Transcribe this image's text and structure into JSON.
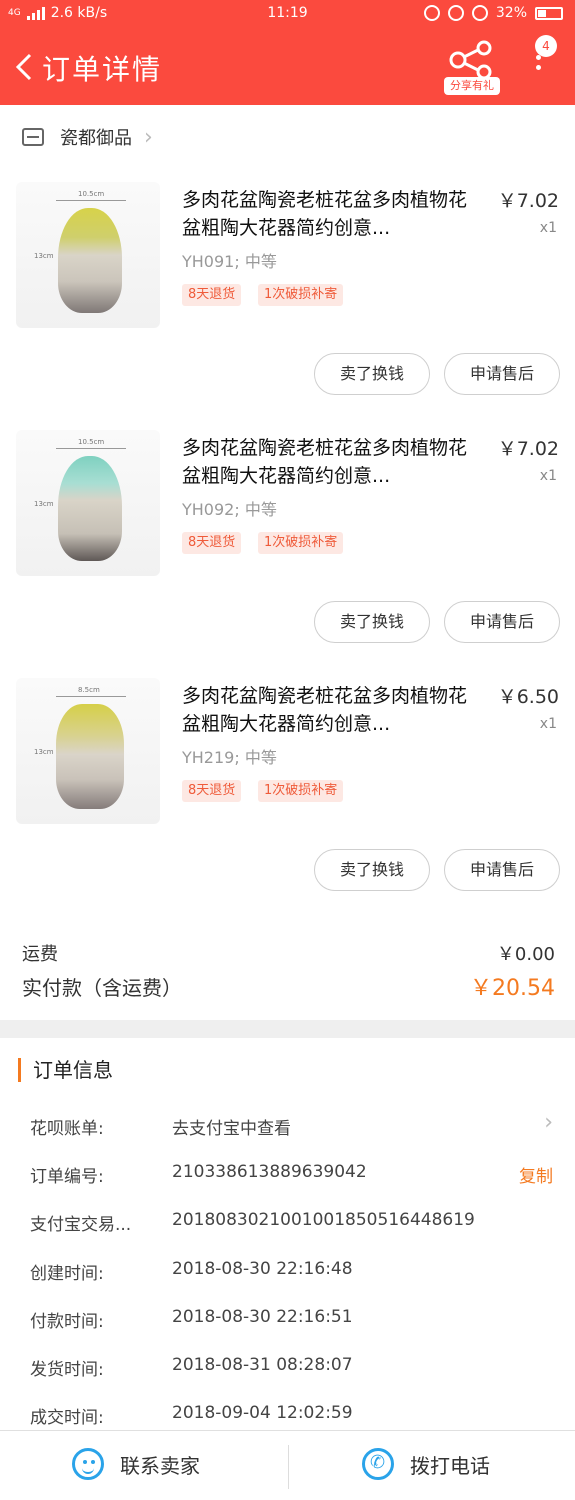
{
  "status_bar": {
    "network": "4G",
    "speed": "2.6 kB/s",
    "time": "11:19",
    "battery": "32%"
  },
  "header": {
    "title": "订单详情",
    "share_label": "分享有礼",
    "badge": "4"
  },
  "store": {
    "name": "瓷都御品"
  },
  "products": [
    {
      "name": "多肉花盆陶瓷老桩花盆多肉植物花盆粗陶大花器简约创意...",
      "price": "￥7.02",
      "qty": "x1",
      "sku": "YH091; 中等",
      "tags": [
        "8天退货",
        "1次破损补寄"
      ],
      "buttons": {
        "sell": "卖了换钱",
        "after_sale": "申请售后"
      }
    },
    {
      "name": "多肉花盆陶瓷老桩花盆多肉植物花盆粗陶大花器简约创意...",
      "price": "￥7.02",
      "qty": "x1",
      "sku": "YH092; 中等",
      "tags": [
        "8天退货",
        "1次破损补寄"
      ],
      "buttons": {
        "sell": "卖了换钱",
        "after_sale": "申请售后"
      }
    },
    {
      "name": "多肉花盆陶瓷老桩花盆多肉植物花盆粗陶大花器简约创意...",
      "price": "￥6.50",
      "qty": "x1",
      "sku": "YH219; 中等",
      "tags": [
        "8天退货",
        "1次破损补寄"
      ],
      "buttons": {
        "sell": "卖了换钱",
        "after_sale": "申请售后"
      }
    }
  ],
  "thumb_labels": [
    "10.5cm",
    "13cm",
    "10.5cm",
    "13cm",
    "8.5cm",
    "13cm"
  ],
  "totals": {
    "shipping_label": "运费",
    "shipping_value": "￥0.00",
    "paid_label": "实付款（含运费）",
    "paid_value": "￥20.54"
  },
  "order_info": {
    "title": "订单信息",
    "rows": [
      {
        "label": "花呗账单:",
        "value": "去支付宝中查看"
      },
      {
        "label": "订单编号:",
        "value": "210338613889639042",
        "action": "复制"
      },
      {
        "label": "支付宝交易...",
        "value": "2018083021001001850516448619"
      },
      {
        "label": "创建时间:",
        "value": "2018-08-30 22:16:48"
      },
      {
        "label": "付款时间:",
        "value": "2018-08-30 22:16:51"
      },
      {
        "label": "发货时间:",
        "value": "2018-08-31 08:28:07"
      },
      {
        "label": "成交时间:",
        "value": "2018-09-04 12:02:59"
      }
    ]
  },
  "bottom_bar": {
    "contact": "联系卖家",
    "call": "拨打电话"
  },
  "colors": {
    "header": "#fb4a3e",
    "accent_orange": "#f47a20",
    "icon_blue": "#2aa3e9"
  }
}
